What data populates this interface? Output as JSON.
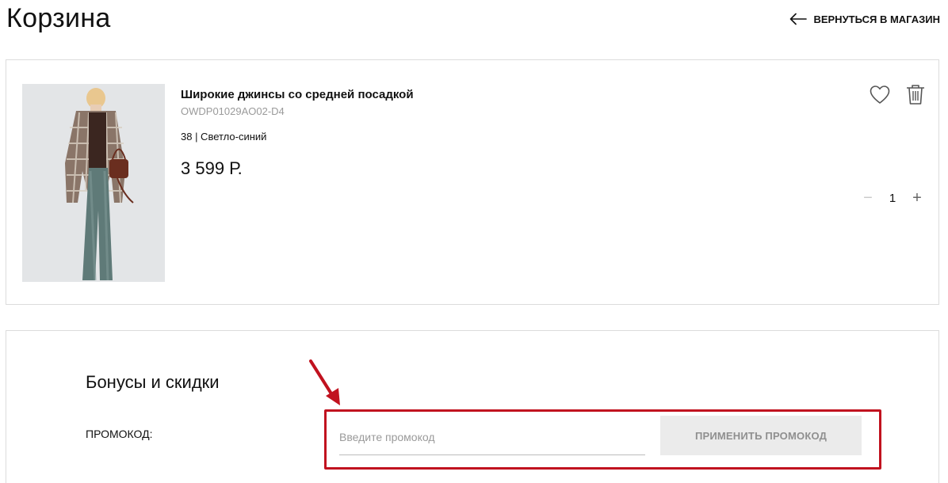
{
  "header": {
    "title": "Корзина",
    "back_label": "ВЕРНУТЬСЯ В МАГАЗИН",
    "back_icon": "arrow-left-icon"
  },
  "cart": {
    "items": [
      {
        "name": "Широкие джинсы со средней посадкой",
        "sku": "OWDP01029AO02-D4",
        "variant": "38 | Светло-синий",
        "price": "3 599 Р.",
        "quantity": "1",
        "favorite_icon": "heart-icon",
        "delete_icon": "trash-icon",
        "decrease_symbol": "−",
        "increase_symbol": "+"
      }
    ]
  },
  "bonuses": {
    "title": "Бонусы и скидки",
    "promo_label": "ПРОМОКОД:",
    "promo_placeholder": "Введите промокод",
    "promo_value": "",
    "apply_label": "ПРИМЕНИТЬ ПРОМОКОД"
  },
  "annotation": {
    "color": "#c1121f"
  },
  "colors": {
    "border": "#dcdcdc",
    "muted_text": "#9a9a9a",
    "button_bg": "#ebebeb"
  }
}
